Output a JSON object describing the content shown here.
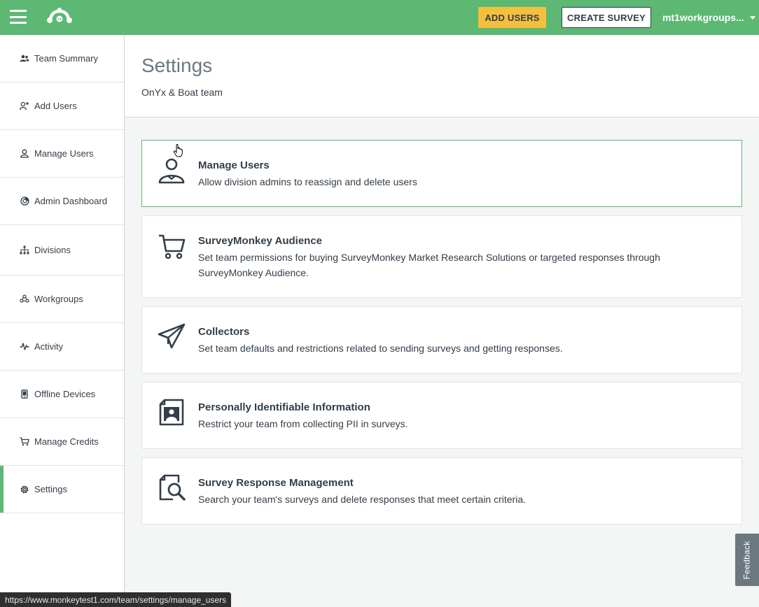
{
  "topbar": {
    "add_users_label": "ADD USERS",
    "create_survey_label": "CREATE SURVEY",
    "account_name": "mt1workgroups..."
  },
  "sidebar": {
    "items": [
      {
        "label": "Team Summary",
        "icon": "team-icon"
      },
      {
        "label": "Add Users",
        "icon": "add-user-icon"
      },
      {
        "label": "Manage Users",
        "icon": "user-icon"
      },
      {
        "label": "Admin Dashboard",
        "icon": "dashboard-icon"
      },
      {
        "label": "Divisions",
        "icon": "divisions-icon"
      },
      {
        "label": "Workgroups",
        "icon": "workgroups-icon"
      },
      {
        "label": "Activity",
        "icon": "activity-icon"
      },
      {
        "label": "Offline Devices",
        "icon": "device-icon"
      },
      {
        "label": "Manage Credits",
        "icon": "cart-icon"
      },
      {
        "label": "Settings",
        "icon": "gear-icon",
        "active": true
      }
    ]
  },
  "header": {
    "title": "Settings",
    "subtitle": "OnYx & Boat team"
  },
  "cards": [
    {
      "title": "Manage Users",
      "description": "Allow division admins to reassign and delete users",
      "icon": "user-icon"
    },
    {
      "title": "SurveyMonkey Audience",
      "description": "Set team permissions for buying SurveyMonkey Market Research Solutions or targeted responses through SurveyMonkey Audience.",
      "icon": "cart-icon"
    },
    {
      "title": "Collectors",
      "description": "Set team defaults and restrictions related to sending surveys and getting responses.",
      "icon": "paper-plane-icon"
    },
    {
      "title": "Personally Identifiable Information",
      "description": "Restrict your team from collecting PII in surveys.",
      "icon": "id-card-icon"
    },
    {
      "title": "Survey Response Management",
      "description": "Search your team's surveys and delete responses that meet certain criteria.",
      "icon": "search-document-icon"
    }
  ],
  "feedback_label": "Feedback",
  "status_url": "https://www.monkeytest1.com/team/settings/manage_users",
  "colors": {
    "brand_green": "#5db873",
    "accent_yellow": "#f5bf3c",
    "text_dark": "#333e48"
  }
}
